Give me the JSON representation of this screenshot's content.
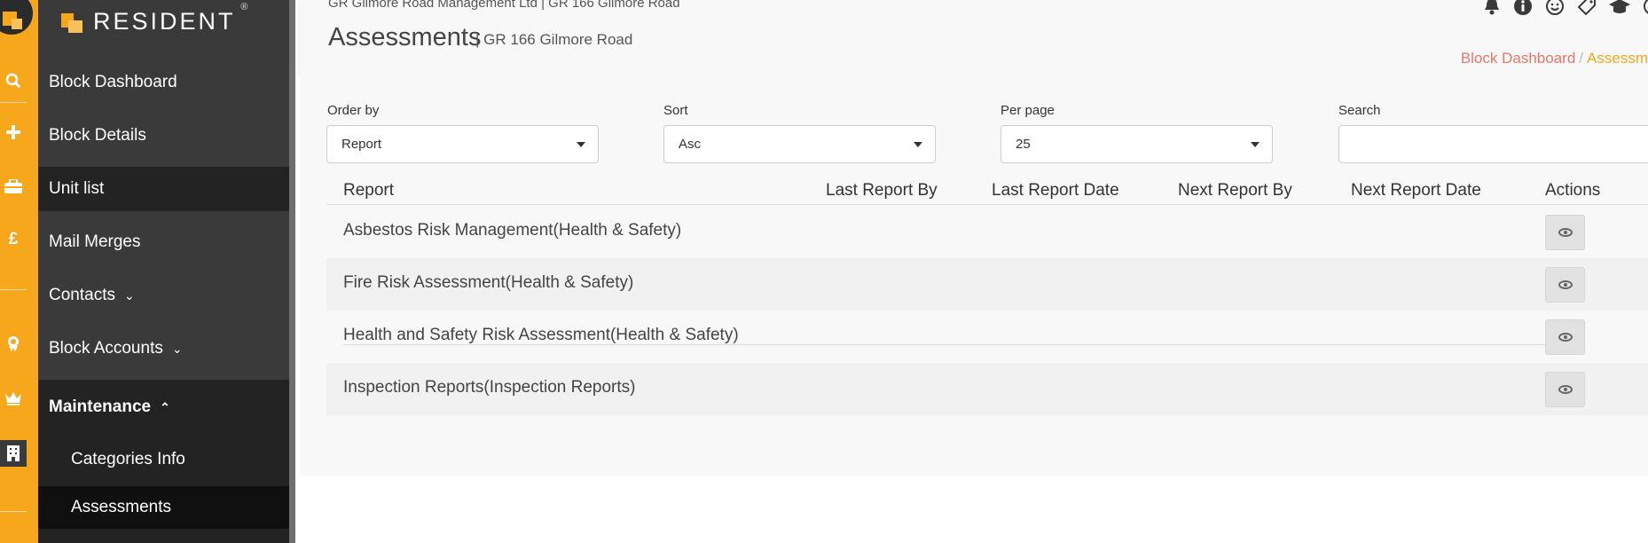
{
  "brand": {
    "name": "RESIDENT",
    "reg_mark": "®"
  },
  "rail": {
    "icons": [
      "search-icon",
      "plus-icon",
      "briefcase-icon",
      "pound-icon",
      "badge-icon",
      "crown-icon",
      "building-icon"
    ]
  },
  "sidebar": {
    "items": [
      {
        "label": "Block Dashboard"
      },
      {
        "label": "Block Details"
      },
      {
        "label": "Unit list"
      },
      {
        "label": "Mail Merges"
      },
      {
        "label": "Contacts",
        "chevron": "⌄"
      },
      {
        "label": "Block Accounts",
        "chevron": "⌄"
      },
      {
        "label": "Maintenance",
        "chevron": "⌃"
      },
      {
        "label": "Categories Info"
      },
      {
        "label": "Assessments"
      }
    ]
  },
  "header": {
    "company": "GR Gilmore Road Management Ltd | GR 166 Gilmore Road",
    "title": "Assessments",
    "subtitle": "| GR 166 Gilmore Road",
    "breadcrumb": {
      "home": "Block Dashboard",
      "separator": "/",
      "current": "Assessm"
    }
  },
  "filters": {
    "order_by": {
      "label": "Order by",
      "value": "Report"
    },
    "sort": {
      "label": "Sort",
      "value": "Asc"
    },
    "per_page": {
      "label": "Per page",
      "value": "25"
    },
    "search": {
      "label": "Search",
      "value": ""
    }
  },
  "table": {
    "headers": [
      "Report",
      "Last Report By",
      "Last Report Date",
      "Next Report By",
      "Next Report Date",
      "Actions"
    ],
    "rows": [
      {
        "report": "Asbestos Risk Management(Health & Safety)"
      },
      {
        "report": "Fire Risk Assessment(Health & Safety)"
      },
      {
        "report": "Health and Safety Risk Assessment(Health & Safety)"
      },
      {
        "report": "Inspection Reports(Inspection Reports)"
      }
    ]
  },
  "colors": {
    "accent": "#f6a71b",
    "breadcrumb_link": "#e8756b",
    "sidebar_bg": "#3a3a3a"
  }
}
